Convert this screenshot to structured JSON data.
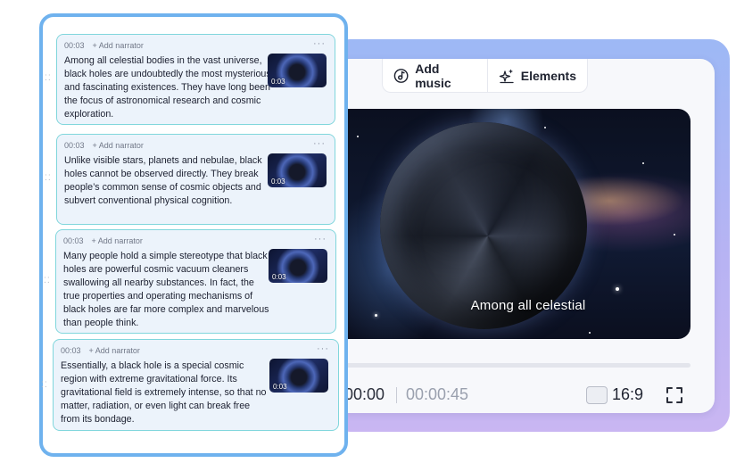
{
  "editor": {
    "toolbar": {
      "add_music_label": "Add music",
      "elements_label": "Elements"
    },
    "preview": {
      "caption": "Among all celestial"
    },
    "playback": {
      "current_time": "00:00",
      "total_time": "00:00:45",
      "aspect_ratio": "16:9"
    }
  },
  "script": {
    "cards": [
      {
        "time": "00:03",
        "add_narrator": "Add narrator",
        "menu": "···",
        "text": "Among all celestial bodies in the vast universe, black holes are undoubtedly the most mysterious and fascinating existences. They have long been the focus of astronomical research and cosmic exploration.",
        "thumb_time": "0:03"
      },
      {
        "time": "00:03",
        "add_narrator": "Add narrator",
        "menu": "···",
        "text": "Unlike visible stars, planets and nebulae, black holes cannot be observed directly. They break people’s common sense of cosmic objects and subvert conventional physical cognition.",
        "thumb_time": "0:03"
      },
      {
        "time": "00:03",
        "add_narrator": "Add narrator",
        "menu": "···",
        "text": "Many people hold a simple stereotype that black holes are powerful cosmic vacuum cleaners swallowing all nearby substances. In fact, the true properties and operating mechanisms of black holes are far more complex and marvelous than people think.",
        "thumb_time": "0:03"
      },
      {
        "time": "00:03",
        "add_narrator": "Add narrator",
        "menu": "···",
        "text": "Essentially, a black hole is a special cosmic region with extreme gravitational force. Its gravitational field is extremely intense, so that no matter, radiation, or even light can break free from its bondage.",
        "thumb_time": "0:03"
      }
    ]
  },
  "colors": {
    "panel_border": "#6fb2ee",
    "card_border": "#80d6dc",
    "card_bg": "#ecf3fb",
    "glow_top": "#9db8f5",
    "glow_bottom": "#c9b6f2"
  },
  "icons": {
    "add_music": "music-note-icon",
    "elements": "sparkle-icon",
    "fullscreen": "fullscreen-icon",
    "drag": "drag-handle-icon",
    "menu": "more-dots-icon",
    "plus": "plus-icon"
  }
}
